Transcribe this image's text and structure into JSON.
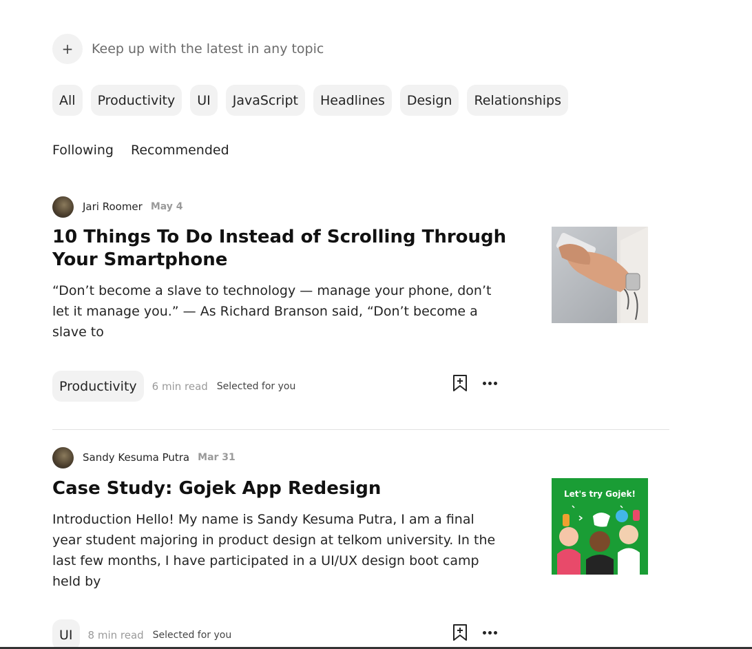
{
  "topic_prompt": {
    "plus": "+",
    "text": "Keep up with the latest in any topic"
  },
  "chips": [
    "All",
    "Productivity",
    "UI",
    "JavaScript",
    "Headlines",
    "Design",
    "Relationships"
  ],
  "feed_tabs": {
    "following": "Following",
    "recommended": "Recommended"
  },
  "articles": [
    {
      "author": "Jari Roomer",
      "date": "May 4",
      "title": "10 Things To Do Instead of Scrolling Through Your Smartphone",
      "excerpt": "“Don’t become a slave to technology — manage your phone, don’t let it manage you.” — As Richard Branson said, “Don’t become a slave to",
      "tag": "Productivity",
      "read_time": "6 min read",
      "selected": "Selected for you",
      "thumbnail_icon": "hands-holding-phone-photo"
    },
    {
      "author": "Sandy Kesuma Putra",
      "date": "Mar 31",
      "title": "Case Study: Gojek App Redesign",
      "excerpt": "Introduction Hello! My name is Sandy Kesuma Putra, I am a final year student majoring in product design at telkom university. In the last few months, I have participated in a UI/UX design boot camp held by",
      "tag": "UI",
      "read_time": "8 min read",
      "selected": "Selected for you",
      "thumbnail_text": "Let's try Gojek!",
      "thumbnail_bg": "#1a9d35"
    }
  ],
  "icons": {
    "bookmark": "bookmark-add-icon",
    "more": "more-options-icon"
  }
}
